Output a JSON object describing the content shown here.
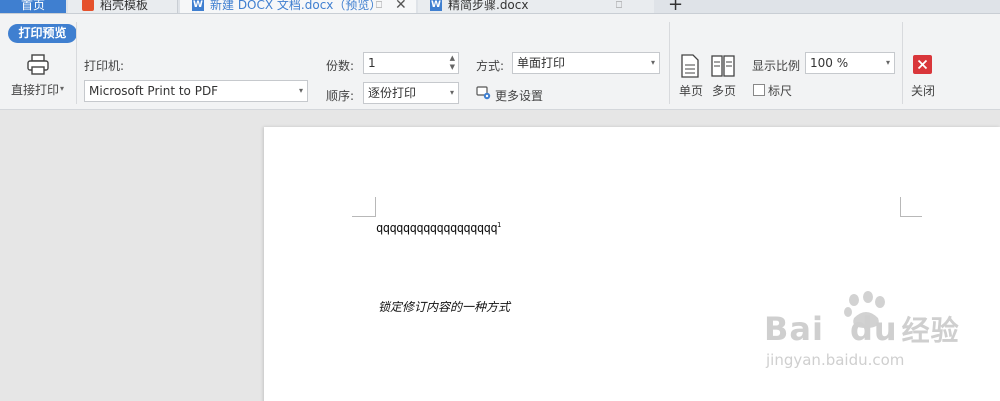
{
  "tabs": {
    "home": "首页",
    "templates": "稻壳模板",
    "doc1": "新建 DOCX 文档.docx（预览）",
    "doc2": "精简步骤.docx",
    "new_tab": "+"
  },
  "toolbar": {
    "print_preview": "打印预览",
    "direct_print": "直接打印",
    "printer_label": "打印机:",
    "printer_value": "Microsoft Print to PDF",
    "copies_label": "份数:",
    "copies_value": "1",
    "order_label": "顺序:",
    "order_value": "逐份打印",
    "mode_label": "方式:",
    "mode_value": "单面打印",
    "more_settings": "更多设置",
    "single_page": "单页",
    "multi_page": "多页",
    "zoom_label": "显示比例",
    "zoom_value": "100 %",
    "ruler_label": "标尺",
    "close": "关闭"
  },
  "document": {
    "line1": "qqqqqqqqqqqqqqqqqq",
    "footnote_mark": "1",
    "line2": "锁定修订内容的一种方式"
  },
  "watermark": {
    "brand": "Bai",
    "brand2": "du",
    "brand_cn": "经验",
    "url": "jingyan.baidu.com"
  },
  "colors": {
    "accent": "#3f7fd0",
    "close_red": "#d9363a",
    "toolbar_bg": "#f2f3f4"
  }
}
